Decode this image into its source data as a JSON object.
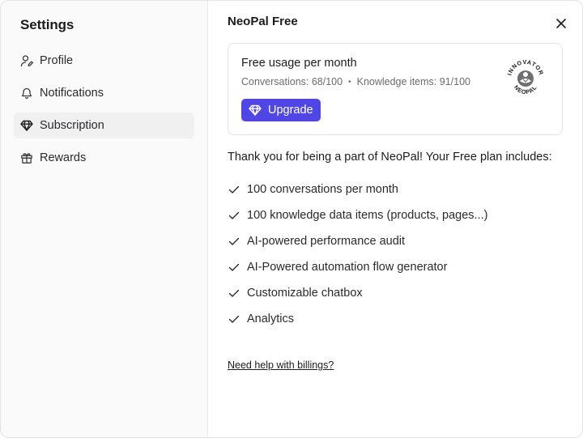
{
  "sidebar": {
    "title": "Settings",
    "items": [
      {
        "label": "Profile",
        "icon": "user-pen-icon"
      },
      {
        "label": "Notifications",
        "icon": "bell-icon"
      },
      {
        "label": "Subscription",
        "icon": "gem-icon",
        "active": true
      },
      {
        "label": "Rewards",
        "icon": "gift-icon"
      }
    ]
  },
  "main": {
    "title": "NeoPal Free",
    "usage": {
      "title": "Free usage per month",
      "conversations": "Conversations: 68/100",
      "knowledge": "Knowledge items: 91/100",
      "separator": "•",
      "upgrade_label": "Upgrade",
      "badge_top": "INNOVATOR",
      "badge_bottom": "NEOPAL"
    },
    "plan_intro": "Thank you for being a part of NeoPal! Your Free plan includes:",
    "features": [
      "100 conversations per month",
      "100 knowledge data items (products, pages...)",
      "AI-powered performance audit",
      "AI-Powered automation flow generator",
      "Customizable chatbox",
      "Analytics"
    ],
    "help_link": "Need help with billings?"
  },
  "colors": {
    "accent": "#4f46e5",
    "sidebar_bg": "#fafafa",
    "active_item_bg": "#f0f0f1",
    "muted_text": "#6b6b70"
  }
}
